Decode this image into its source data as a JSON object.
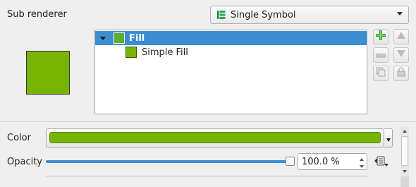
{
  "sub_renderer": {
    "label": "Sub renderer",
    "selected": "Single Symbol"
  },
  "symbol_tree": {
    "items": [
      {
        "label": "Fill",
        "selected": true,
        "expanded": true
      },
      {
        "label": "Simple Fill",
        "selected": false
      }
    ]
  },
  "color": {
    "label": "Color",
    "value": "#77b404"
  },
  "opacity": {
    "label": "Opacity",
    "value": "100.0 %",
    "level": 1.0
  },
  "icons": {
    "renderer": "single-symbol-icon",
    "add_layer": "add-symbol-layer-icon",
    "remove_layer": "remove-symbol-layer-icon",
    "duplicate_layer": "duplicate-layer-icon",
    "move_up": "move-up-icon",
    "move_down": "move-down-icon",
    "lock": "lock-layer-icon",
    "data_defined": "data-defined-override-icon"
  }
}
